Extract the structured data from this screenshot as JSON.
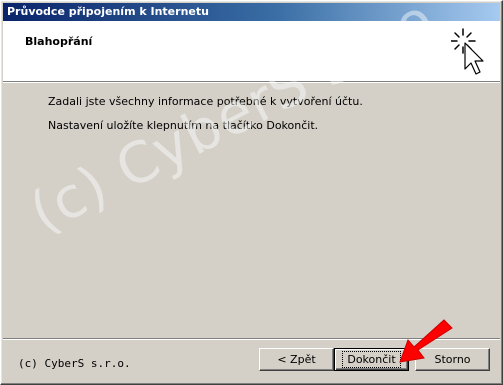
{
  "window": {
    "title": "Průvodce připojením k Internetu"
  },
  "header": {
    "title": "Blahopřání",
    "icon": "wizard-sparkle-cursor-icon"
  },
  "content": {
    "line1": "Zadali jste všechny informace potřebné k vytvoření účtu.",
    "line2": "Nastavení uložíte klepnutím na tlačítko Dokončit."
  },
  "watermark": {
    "text": "(c) CyberS s.r.o."
  },
  "footer": {
    "copyright": "(c) CyberS s.r.o."
  },
  "buttons": {
    "back_label": "< Zpět",
    "finish_label": "Dokončit",
    "cancel_label": "Storno"
  },
  "annotation": {
    "arrow_color": "#ff0000",
    "icon": "red-arrow-icon"
  },
  "colors": {
    "titlebar_start": "#0a246a",
    "titlebar_end": "#a6caf0",
    "dialog_bg": "#d4d0c8"
  }
}
